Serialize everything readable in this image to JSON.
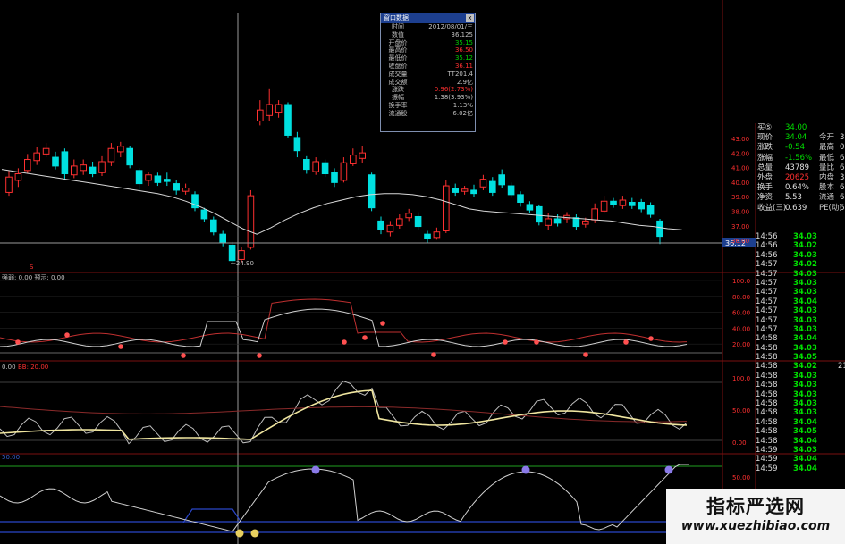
{
  "info_window": {
    "title": "窗口数据",
    "close": "x",
    "rows": [
      {
        "label": "时间",
        "value": "2012/08/01/三",
        "color": "#c0c0c0"
      },
      {
        "label": "数值",
        "value": "36.125",
        "color": "#c0c0c0"
      },
      {
        "label": "开盘价",
        "value": "35.15",
        "color": "#00d000"
      },
      {
        "label": "最高价",
        "value": "36.50",
        "color": "#ff3030"
      },
      {
        "label": "最低价",
        "value": "35.12",
        "color": "#00d000"
      },
      {
        "label": "收盘价",
        "value": "36.11",
        "color": "#ff3030"
      },
      {
        "label": "成交量",
        "value": "TT201.4",
        "color": "#c0c0c0"
      },
      {
        "label": "成交额",
        "value": "2.9亿",
        "color": "#c0c0c0"
      },
      {
        "label": "涨跌",
        "value": "0.96(2.73%)",
        "color": "#ff3030"
      },
      {
        "label": "振幅",
        "value": "1.38(3.93%)",
        "color": "#c0c0c0"
      },
      {
        "label": "换手率",
        "value": "1.13%",
        "color": "#c0c0c0"
      },
      {
        "label": "流通股",
        "value": "6.02亿",
        "color": "#c0c0c0"
      }
    ]
  },
  "chart": {
    "low_marker": "24.90",
    "crosshair_price": "36.12",
    "price_axis": [
      "43.00",
      "42.00",
      "41.00",
      "40.00",
      "39.00",
      "38.00",
      "37.00",
      "36.00"
    ],
    "indicator_1_legend": "强弱: 0.00  预示: 0.00",
    "indicator_1_axis": [
      "100.0",
      "80.00",
      "60.00",
      "40.00",
      "20.00"
    ],
    "indicator_2_legend_a": "0.00",
    "indicator_2_legend_b": "BB: 20.00",
    "indicator_2_axis": [
      "100.0",
      "50.00",
      "0.00"
    ],
    "indicator_3_legend": "50.00",
    "indicator_3_axis": [
      "50.00"
    ],
    "bottom_date": "2012/08/01/三",
    "candles": [
      {
        "o": 40.8,
        "c": 42.2,
        "h": 42.8,
        "l": 40.5
      },
      {
        "o": 41.9,
        "c": 42.5,
        "h": 43.0,
        "l": 41.3
      },
      {
        "o": 42.8,
        "c": 43.8,
        "h": 44.3,
        "l": 42.5
      },
      {
        "o": 43.7,
        "c": 44.4,
        "h": 44.9,
        "l": 43.3
      },
      {
        "o": 44.3,
        "c": 44.8,
        "h": 45.3,
        "l": 44.0
      },
      {
        "o": 44.0,
        "c": 43.2,
        "h": 44.5,
        "l": 42.9
      },
      {
        "o": 44.5,
        "c": 42.5,
        "h": 44.8,
        "l": 42.0
      },
      {
        "o": 42.4,
        "c": 43.2,
        "h": 43.8,
        "l": 42.1
      },
      {
        "o": 42.8,
        "c": 43.3,
        "h": 43.8,
        "l": 42.4
      },
      {
        "o": 43.1,
        "c": 42.5,
        "h": 43.6,
        "l": 42.2
      },
      {
        "o": 42.6,
        "c": 43.6,
        "h": 44.1,
        "l": 42.3
      },
      {
        "o": 43.6,
        "c": 44.8,
        "h": 45.3,
        "l": 43.2
      },
      {
        "o": 44.5,
        "c": 45.0,
        "h": 45.4,
        "l": 44.0
      },
      {
        "o": 44.8,
        "c": 43.3,
        "h": 45.0,
        "l": 43.0
      },
      {
        "o": 42.8,
        "c": 41.6,
        "h": 43.0,
        "l": 41.0
      },
      {
        "o": 41.9,
        "c": 42.4,
        "h": 42.7,
        "l": 41.4
      },
      {
        "o": 42.3,
        "c": 41.7,
        "h": 42.6,
        "l": 41.4
      },
      {
        "o": 42.0,
        "c": 41.8,
        "h": 42.6,
        "l": 41.4
      },
      {
        "o": 41.6,
        "c": 41.0,
        "h": 41.9,
        "l": 40.6
      },
      {
        "o": 40.9,
        "c": 41.2,
        "h": 41.6,
        "l": 40.6
      },
      {
        "o": 40.6,
        "c": 39.4,
        "h": 40.9,
        "l": 39.1
      },
      {
        "o": 39.2,
        "c": 38.4,
        "h": 39.4,
        "l": 38.1
      },
      {
        "o": 38.3,
        "c": 37.2,
        "h": 38.6,
        "l": 36.9
      },
      {
        "o": 37.0,
        "c": 36.2,
        "h": 37.3,
        "l": 35.9
      },
      {
        "o": 36.0,
        "c": 34.6,
        "h": 36.3,
        "l": 34.3
      },
      {
        "o": 34.7,
        "c": 35.5,
        "h": 35.8,
        "l": 34.4
      },
      {
        "o": 35.8,
        "c": 40.5,
        "h": 41.0,
        "l": 35.6
      },
      {
        "o": 47.3,
        "c": 48.3,
        "h": 49.2,
        "l": 46.9
      },
      {
        "o": 47.8,
        "c": 48.8,
        "h": 50.2,
        "l": 47.3
      },
      {
        "o": 48.1,
        "c": 48.8,
        "h": 49.2,
        "l": 47.6
      },
      {
        "o": 48.8,
        "c": 46.0,
        "h": 49.0,
        "l": 45.8
      },
      {
        "o": 45.8,
        "c": 44.6,
        "h": 46.3,
        "l": 44.0
      },
      {
        "o": 43.8,
        "c": 42.9,
        "h": 44.1,
        "l": 42.5
      },
      {
        "o": 42.7,
        "c": 43.6,
        "h": 44.0,
        "l": 42.4
      },
      {
        "o": 43.5,
        "c": 42.5,
        "h": 43.8,
        "l": 42.2
      },
      {
        "o": 42.6,
        "c": 41.7,
        "h": 43.0,
        "l": 41.3
      },
      {
        "o": 41.9,
        "c": 43.5,
        "h": 44.0,
        "l": 41.7
      },
      {
        "o": 43.4,
        "c": 44.2,
        "h": 44.8,
        "l": 43.2
      },
      {
        "o": 43.9,
        "c": 44.4,
        "h": 45.0,
        "l": 43.5
      },
      {
        "o": 42.4,
        "c": 39.4,
        "h": 42.6,
        "l": 39.1
      },
      {
        "o": 38.2,
        "c": 37.4,
        "h": 38.6,
        "l": 37.0
      },
      {
        "o": 37.2,
        "c": 37.8,
        "h": 38.2,
        "l": 36.8
      },
      {
        "o": 37.8,
        "c": 38.4,
        "h": 38.8,
        "l": 37.5
      },
      {
        "o": 38.5,
        "c": 38.9,
        "h": 39.3,
        "l": 38.2
      },
      {
        "o": 38.6,
        "c": 37.7,
        "h": 39.0,
        "l": 37.4
      },
      {
        "o": 37.0,
        "c": 36.6,
        "h": 37.3,
        "l": 36.2
      },
      {
        "o": 36.7,
        "c": 37.2,
        "h": 37.6,
        "l": 36.5
      },
      {
        "o": 37.3,
        "c": 41.4,
        "h": 41.9,
        "l": 37.1
      },
      {
        "o": 41.2,
        "c": 40.8,
        "h": 41.6,
        "l": 40.5
      },
      {
        "o": 40.9,
        "c": 41.1,
        "h": 41.4,
        "l": 40.6
      },
      {
        "o": 41.0,
        "c": 40.7,
        "h": 41.5,
        "l": 40.4
      },
      {
        "o": 41.3,
        "c": 42.0,
        "h": 42.4,
        "l": 41.0
      },
      {
        "o": 41.8,
        "c": 40.8,
        "h": 42.2,
        "l": 40.5
      },
      {
        "o": 42.4,
        "c": 41.5,
        "h": 42.9,
        "l": 41.2
      },
      {
        "o": 41.4,
        "c": 40.6,
        "h": 41.7,
        "l": 40.3
      },
      {
        "o": 40.6,
        "c": 39.9,
        "h": 40.9,
        "l": 39.5
      },
      {
        "o": 39.7,
        "c": 39.2,
        "h": 40.0,
        "l": 38.9
      },
      {
        "o": 39.5,
        "c": 38.1,
        "h": 39.7,
        "l": 37.8
      },
      {
        "o": 37.8,
        "c": 38.4,
        "h": 38.9,
        "l": 37.4
      },
      {
        "o": 38.4,
        "c": 38.0,
        "h": 38.8,
        "l": 37.7
      },
      {
        "o": 38.4,
        "c": 38.7,
        "h": 39.0,
        "l": 38.0
      },
      {
        "o": 38.5,
        "c": 37.7,
        "h": 38.8,
        "l": 37.4
      },
      {
        "o": 37.9,
        "c": 38.2,
        "h": 38.5,
        "l": 37.6
      },
      {
        "o": 38.3,
        "c": 39.3,
        "h": 39.8,
        "l": 38.0
      },
      {
        "o": 39.1,
        "c": 40.0,
        "h": 40.5,
        "l": 38.9
      },
      {
        "o": 40.0,
        "c": 39.7,
        "h": 40.3,
        "l": 39.4
      },
      {
        "o": 39.6,
        "c": 40.1,
        "h": 40.5,
        "l": 39.3
      },
      {
        "o": 39.9,
        "c": 39.6,
        "h": 40.3,
        "l": 39.3
      },
      {
        "o": 39.9,
        "c": 39.3,
        "h": 40.2,
        "l": 39.0
      },
      {
        "o": 39.6,
        "c": 38.8,
        "h": 39.9,
        "l": 38.5
      },
      {
        "o": 38.2,
        "c": 36.8,
        "h": 38.4,
        "l": 36.1
      }
    ],
    "ma_line": [
      42.9,
      42.7,
      42.5,
      42.3,
      42.1,
      41.9,
      41.7,
      41.5,
      41.3,
      41.1,
      40.9,
      40.7,
      40.4,
      40.0,
      39.5,
      38.9,
      38.2,
      37.5,
      37.0,
      37.6,
      38.3,
      38.9,
      39.4,
      39.8,
      40.1,
      40.4,
      40.6,
      40.7,
      40.7,
      40.6,
      40.4,
      40.1,
      39.7,
      39.3,
      39.1,
      39.0,
      38.9,
      38.8,
      38.7,
      38.6,
      38.5,
      38.4,
      38.3,
      38.2,
      38.0,
      37.8,
      37.7,
      37.5,
      37.4
    ]
  },
  "quote_panel": {
    "rows": [
      {
        "label": "买⑤",
        "value": "34.00",
        "vcolor": "#00e000",
        "extra": "",
        "ecolor": "#ccc"
      },
      {
        "label": "现价",
        "value": "34.04",
        "vcolor": "#00e000",
        "extra": "今开",
        "ecolor": "#ccc"
      },
      {
        "label": "涨跌",
        "value": "-0.54",
        "vcolor": "#00e000",
        "extra": "最高",
        "ecolor": "#ccc"
      },
      {
        "label": "涨幅",
        "value": "-1.56%",
        "vcolor": "#00e000",
        "extra": "最低",
        "ecolor": "#ccc"
      },
      {
        "label": "总量",
        "value": "43789",
        "vcolor": "#e0e0e0",
        "extra": "量比",
        "ecolor": "#ccc"
      },
      {
        "label": "外盘",
        "value": "20625",
        "vcolor": "#ff3030",
        "extra": "内盘",
        "ecolor": "#ccc"
      },
      {
        "label": "换手",
        "value": "0.64%",
        "vcolor": "#e0e0e0",
        "extra": "股本",
        "ecolor": "#ccc"
      },
      {
        "label": "净资",
        "value": "5.53",
        "vcolor": "#e0e0e0",
        "extra": "流通",
        "ecolor": "#ccc"
      },
      {
        "label": "收益(三)",
        "value": "0.639",
        "vcolor": "#e0e0e0",
        "extra": "PE(动)",
        "ecolor": "#ccc"
      }
    ],
    "right_edge": [
      "3",
      "0",
      "6",
      "6",
      "3",
      "6",
      "6",
      "6"
    ]
  },
  "ticks": [
    {
      "t": "14:56",
      "p": "34.03",
      "v": ""
    },
    {
      "t": "14:56",
      "p": "34.02",
      "v": ""
    },
    {
      "t": "14:56",
      "p": "34.03",
      "v": ""
    },
    {
      "t": "14:57",
      "p": "34.02",
      "v": ""
    },
    {
      "t": "14:57",
      "p": "34.03",
      "v": ""
    },
    {
      "t": "14:57",
      "p": "34.03",
      "v": ""
    },
    {
      "t": "14:57",
      "p": "34.03",
      "v": ""
    },
    {
      "t": "14:57",
      "p": "34.04",
      "v": ""
    },
    {
      "t": "14:57",
      "p": "34.03",
      "v": ""
    },
    {
      "t": "14:57",
      "p": "34.03",
      "v": ""
    },
    {
      "t": "14:57",
      "p": "34.03",
      "v": ""
    },
    {
      "t": "14:58",
      "p": "34.04",
      "v": ""
    },
    {
      "t": "14:58",
      "p": "34.03",
      "v": ""
    },
    {
      "t": "14:58",
      "p": "34.05",
      "v": ""
    },
    {
      "t": "14:58",
      "p": "34.02",
      "v": "21"
    },
    {
      "t": "14:58",
      "p": "34.03",
      "v": ""
    },
    {
      "t": "14:58",
      "p": "34.03",
      "v": ""
    },
    {
      "t": "14:58",
      "p": "34.03",
      "v": ""
    },
    {
      "t": "14:58",
      "p": "34.03",
      "v": ""
    },
    {
      "t": "14:58",
      "p": "34.03",
      "v": ""
    },
    {
      "t": "14:58",
      "p": "34.04",
      "v": ""
    },
    {
      "t": "14:58",
      "p": "34.05",
      "v": ""
    },
    {
      "t": "14:58",
      "p": "34.04",
      "v": ""
    },
    {
      "t": "14:59",
      "p": "34.03",
      "v": ""
    },
    {
      "t": "14:59",
      "p": "34.04",
      "v": ""
    },
    {
      "t": "14:59",
      "p": "34.04",
      "v": ""
    }
  ],
  "watermark": {
    "title": "指标严选网",
    "url": "www.xuezhibiao.com"
  }
}
